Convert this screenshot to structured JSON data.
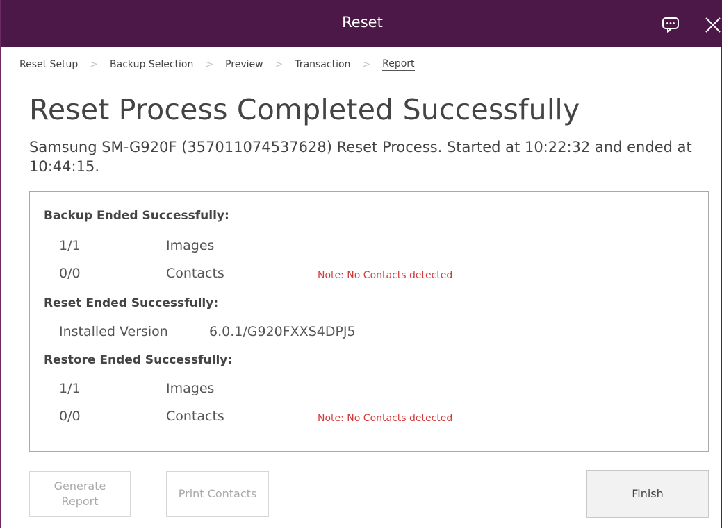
{
  "window": {
    "title": "Reset",
    "feedback_icon": "feedback-icon",
    "close_icon": "close-icon",
    "colors": {
      "titlebar": "#4b1848",
      "note_text": "#d43a3a"
    }
  },
  "breadcrumb": {
    "items": [
      {
        "label": "Reset Setup"
      },
      {
        "label": "Backup Selection"
      },
      {
        "label": "Preview"
      },
      {
        "label": "Transaction"
      },
      {
        "label": "Report"
      }
    ],
    "separator": ">",
    "active_index": 4
  },
  "main": {
    "title": "Reset Process Completed Successfully",
    "subtitle": "Samsung SM-G920F (357011074537628) Reset Process. Started at 10:22:32 and ended at 10:44:15."
  },
  "report": {
    "backup": {
      "heading": "Backup Ended Successfully:",
      "rows": [
        {
          "count": "1/1",
          "label": "Images",
          "note": ""
        },
        {
          "count": "0/0",
          "label": "Contacts",
          "note": "Note: No Contacts detected"
        }
      ]
    },
    "reset": {
      "heading": "Reset Ended Successfully:",
      "installed_version_label": "Installed Version",
      "installed_version_value": "6.0.1/G920FXXS4DPJ5"
    },
    "restore": {
      "heading": "Restore Ended Successfully:",
      "rows": [
        {
          "count": "1/1",
          "label": "Images",
          "note": ""
        },
        {
          "count": "0/0",
          "label": "Contacts",
          "note": "Note: No Contacts detected"
        }
      ]
    }
  },
  "footer": {
    "generate_report_label": "Generate Report",
    "print_contacts_label": "Print Contacts",
    "finish_label": "Finish"
  }
}
